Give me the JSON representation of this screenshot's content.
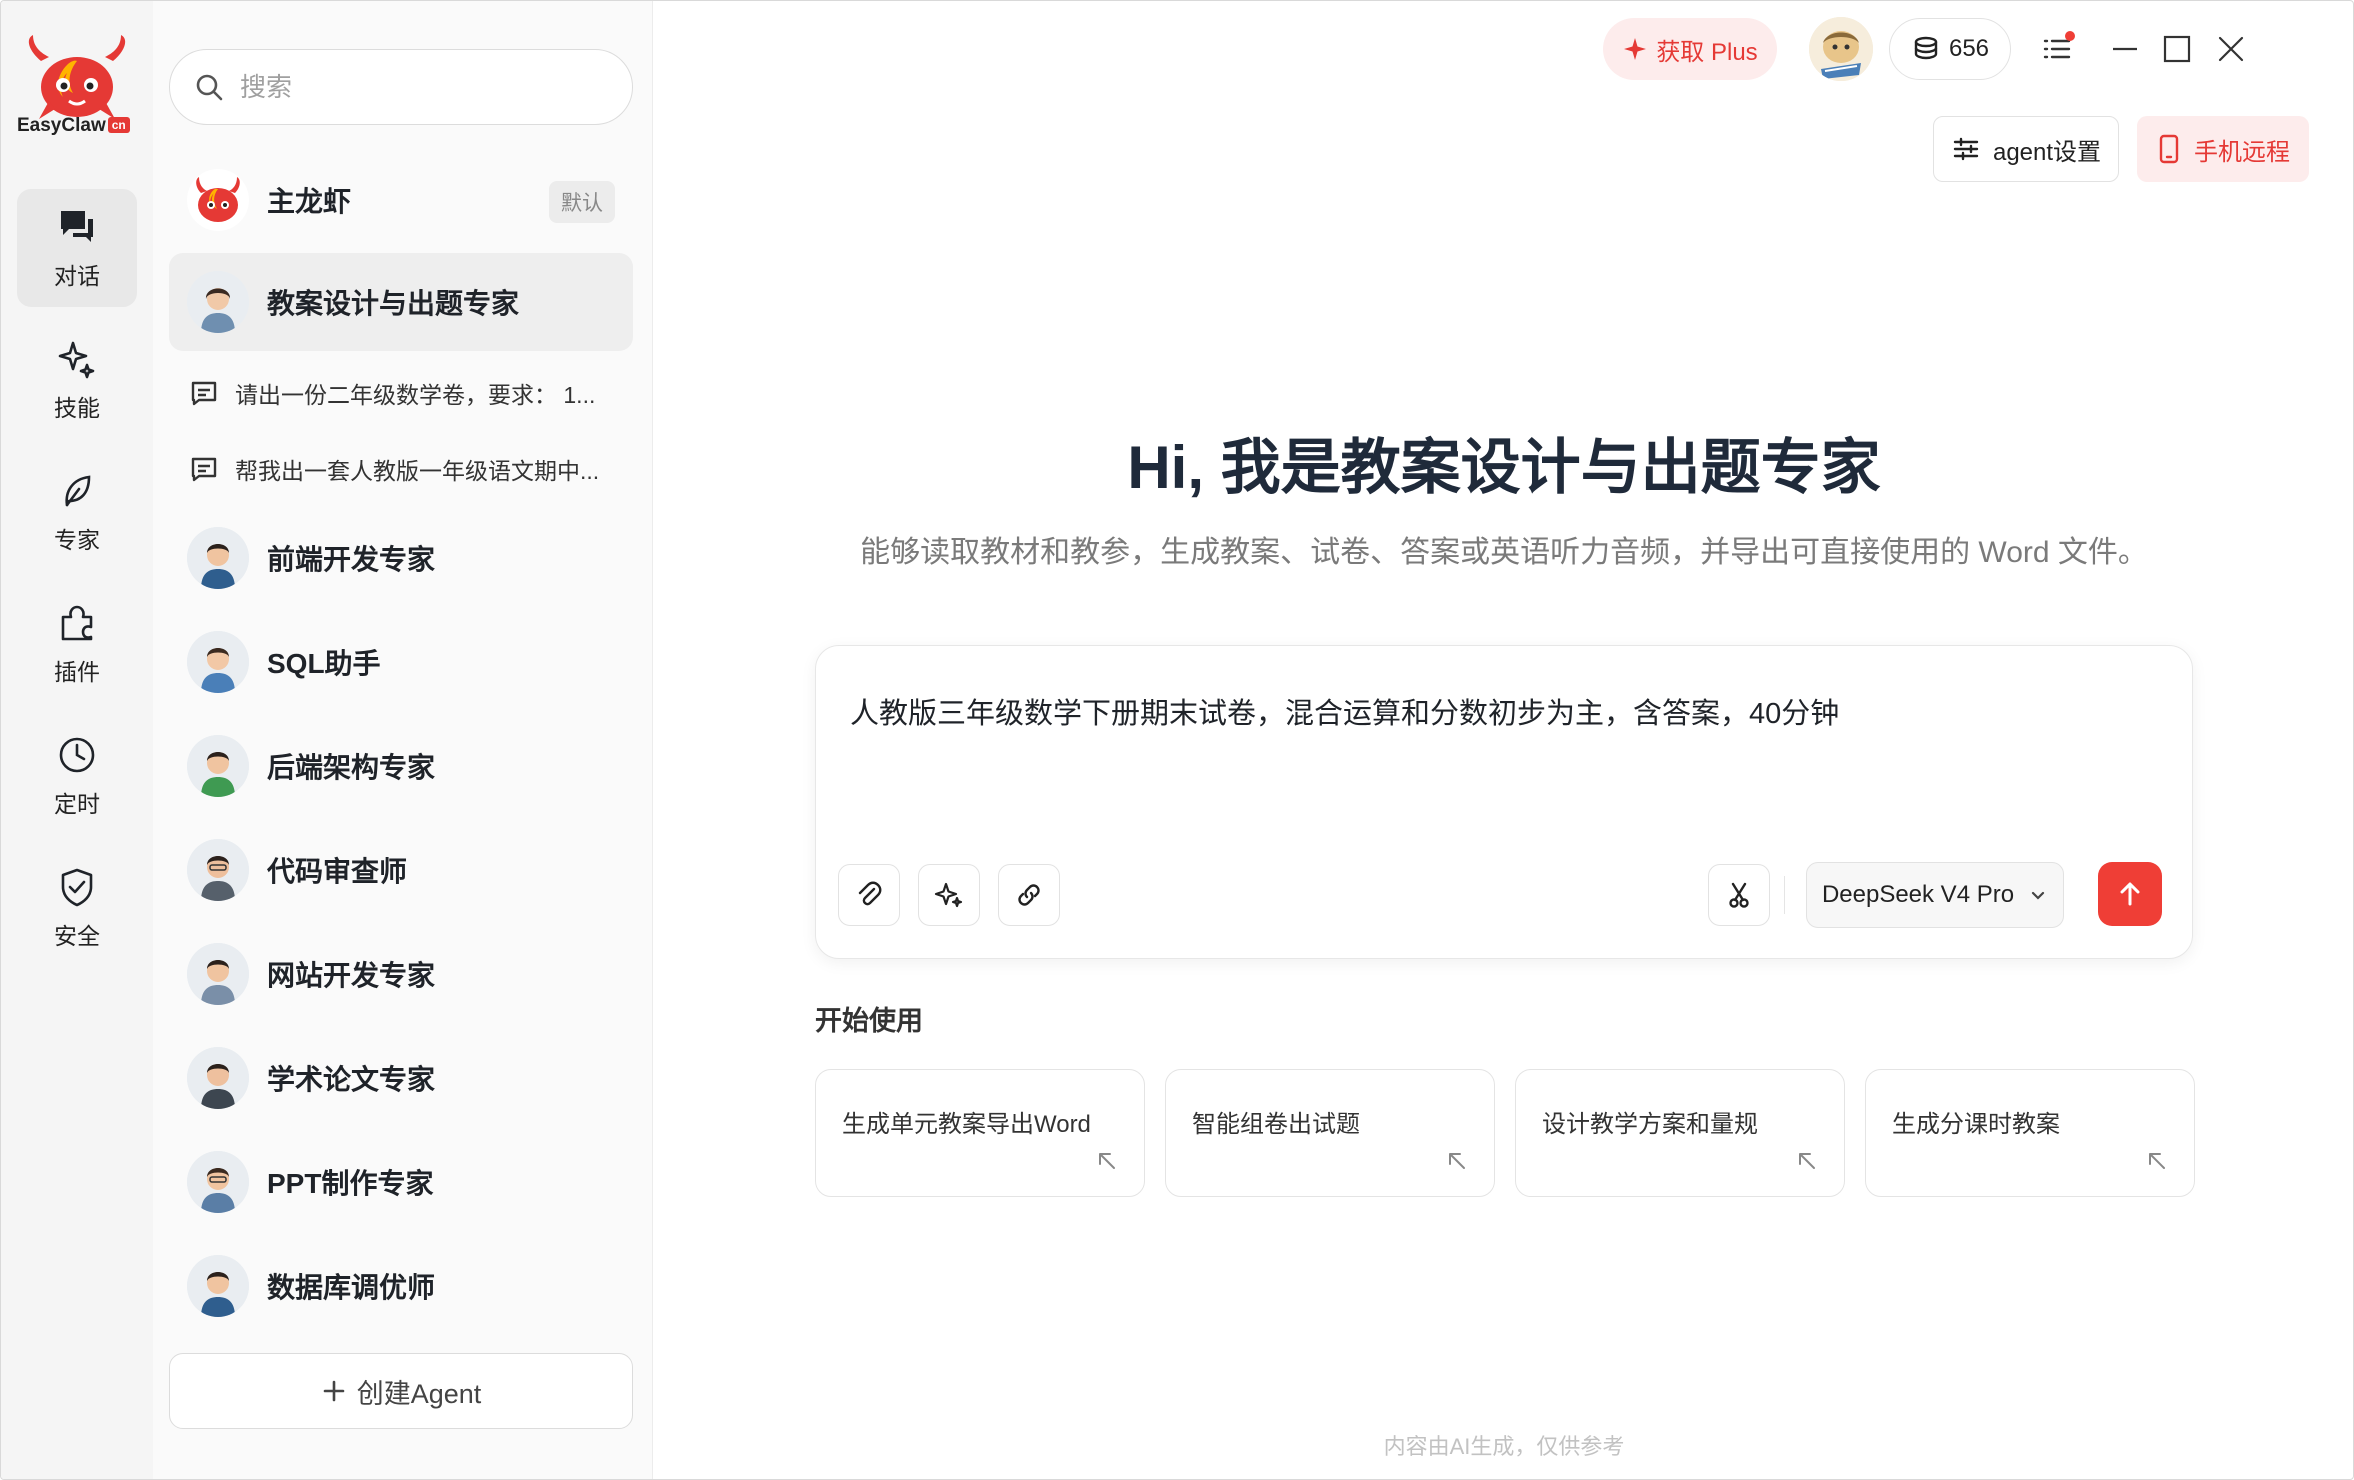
{
  "app": {
    "name": "EasyClaw",
    "badge": "cn"
  },
  "nav": {
    "items": [
      {
        "label": "对话",
        "icon": "chat-bubbles-icon"
      },
      {
        "label": "技能",
        "icon": "sparkle-icon"
      },
      {
        "label": "专家",
        "icon": "leaf-icon"
      },
      {
        "label": "插件",
        "icon": "puzzle-icon"
      },
      {
        "label": "定时",
        "icon": "clock-icon"
      },
      {
        "label": "安全",
        "icon": "shield-check-icon"
      }
    ],
    "active": "对话"
  },
  "search": {
    "placeholder": "搜索"
  },
  "agents": {
    "main": {
      "name": "主龙虾",
      "badge": "默认"
    },
    "selected": {
      "name": "教案设计与出题专家"
    },
    "conversations": [
      "请出一份二年级数学卷，要求：  1...",
      "帮我出一套人教版一年级语文期中..."
    ],
    "list": [
      "前端开发专家",
      "SQL助手",
      "后端架构专家",
      "代码审查师",
      "网站开发专家",
      "学术论文专家",
      "PPT制作专家",
      "数据库调优师"
    ],
    "create_label": "创建Agent"
  },
  "topbar": {
    "plus_label": "获取 Plus",
    "credits": "656",
    "agent_settings": "agent设置",
    "phone_remote": "手机远程"
  },
  "hero": {
    "title": "Hi, 我是教案设计与出题专家",
    "subtitle": "能够读取教材和教参，生成教案、试卷、答案或英语听力音频，并导出可直接使用的 Word 文件。"
  },
  "composer": {
    "text": "人教版三年级数学下册期末试卷，混合运算和分数初步为主，含答案，40分钟",
    "model": "DeepSeek V4 Pro"
  },
  "start": {
    "title": "开始使用",
    "cards": [
      "生成单元教案导出Word",
      "智能组卷出试题",
      "设计教学方案和量规",
      "生成分课时教案"
    ]
  },
  "footer": {
    "note": "内容由AI生成，仅供参考"
  },
  "colors": {
    "accent": "#ef3e36",
    "accent_soft": "#fdecec",
    "rail_bg": "#f5f5f5",
    "panel_bg": "#fafafa"
  }
}
